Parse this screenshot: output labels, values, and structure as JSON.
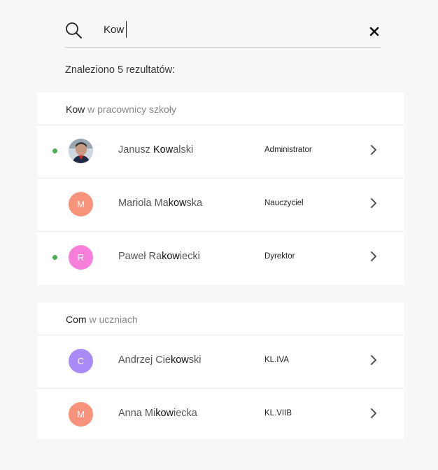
{
  "search": {
    "value": "Kow"
  },
  "results_count": "Znaleziono 5 rezultatów:",
  "sections": [
    {
      "query": "Kow",
      "label": "w pracownicy szkoły",
      "rows": [
        {
          "name_pre": "Janusz ",
          "name_hl": "Kow",
          "name_post": "alski",
          "role": "Administrator",
          "avatar_letter": "",
          "avatar_color": "photo",
          "online": true
        },
        {
          "name_pre": "Mariola Ma",
          "name_hl": "kow",
          "name_post": "ska",
          "role": "Nauczyciel",
          "avatar_letter": "M",
          "avatar_color": "#f7937a",
          "online": false
        },
        {
          "name_pre": "Paweł Ra",
          "name_hl": "kow",
          "name_post": "iecki",
          "role": "Dyrektor",
          "avatar_letter": "R",
          "avatar_color": "#f77fd9",
          "online": true
        }
      ]
    },
    {
      "query": "Com",
      "label": "w uczniach",
      "rows": [
        {
          "name_pre": "Andrzej Cie",
          "name_hl": "kow",
          "name_post": "ski",
          "role": "KL.IVA",
          "avatar_letter": "C",
          "avatar_color": "#a98bf7",
          "online": false
        },
        {
          "name_pre": "Anna Mi",
          "name_hl": "kow",
          "name_post": "iecka",
          "role": "KL.VIIB",
          "avatar_letter": "M",
          "avatar_color": "#f7937a",
          "online": false
        }
      ]
    }
  ],
  "colors": {
    "online": "#4caf50",
    "background": "#f7f7f7"
  },
  "icons": {
    "search": "search-icon",
    "clear": "close-icon",
    "row_action": "chevron-right-icon"
  }
}
